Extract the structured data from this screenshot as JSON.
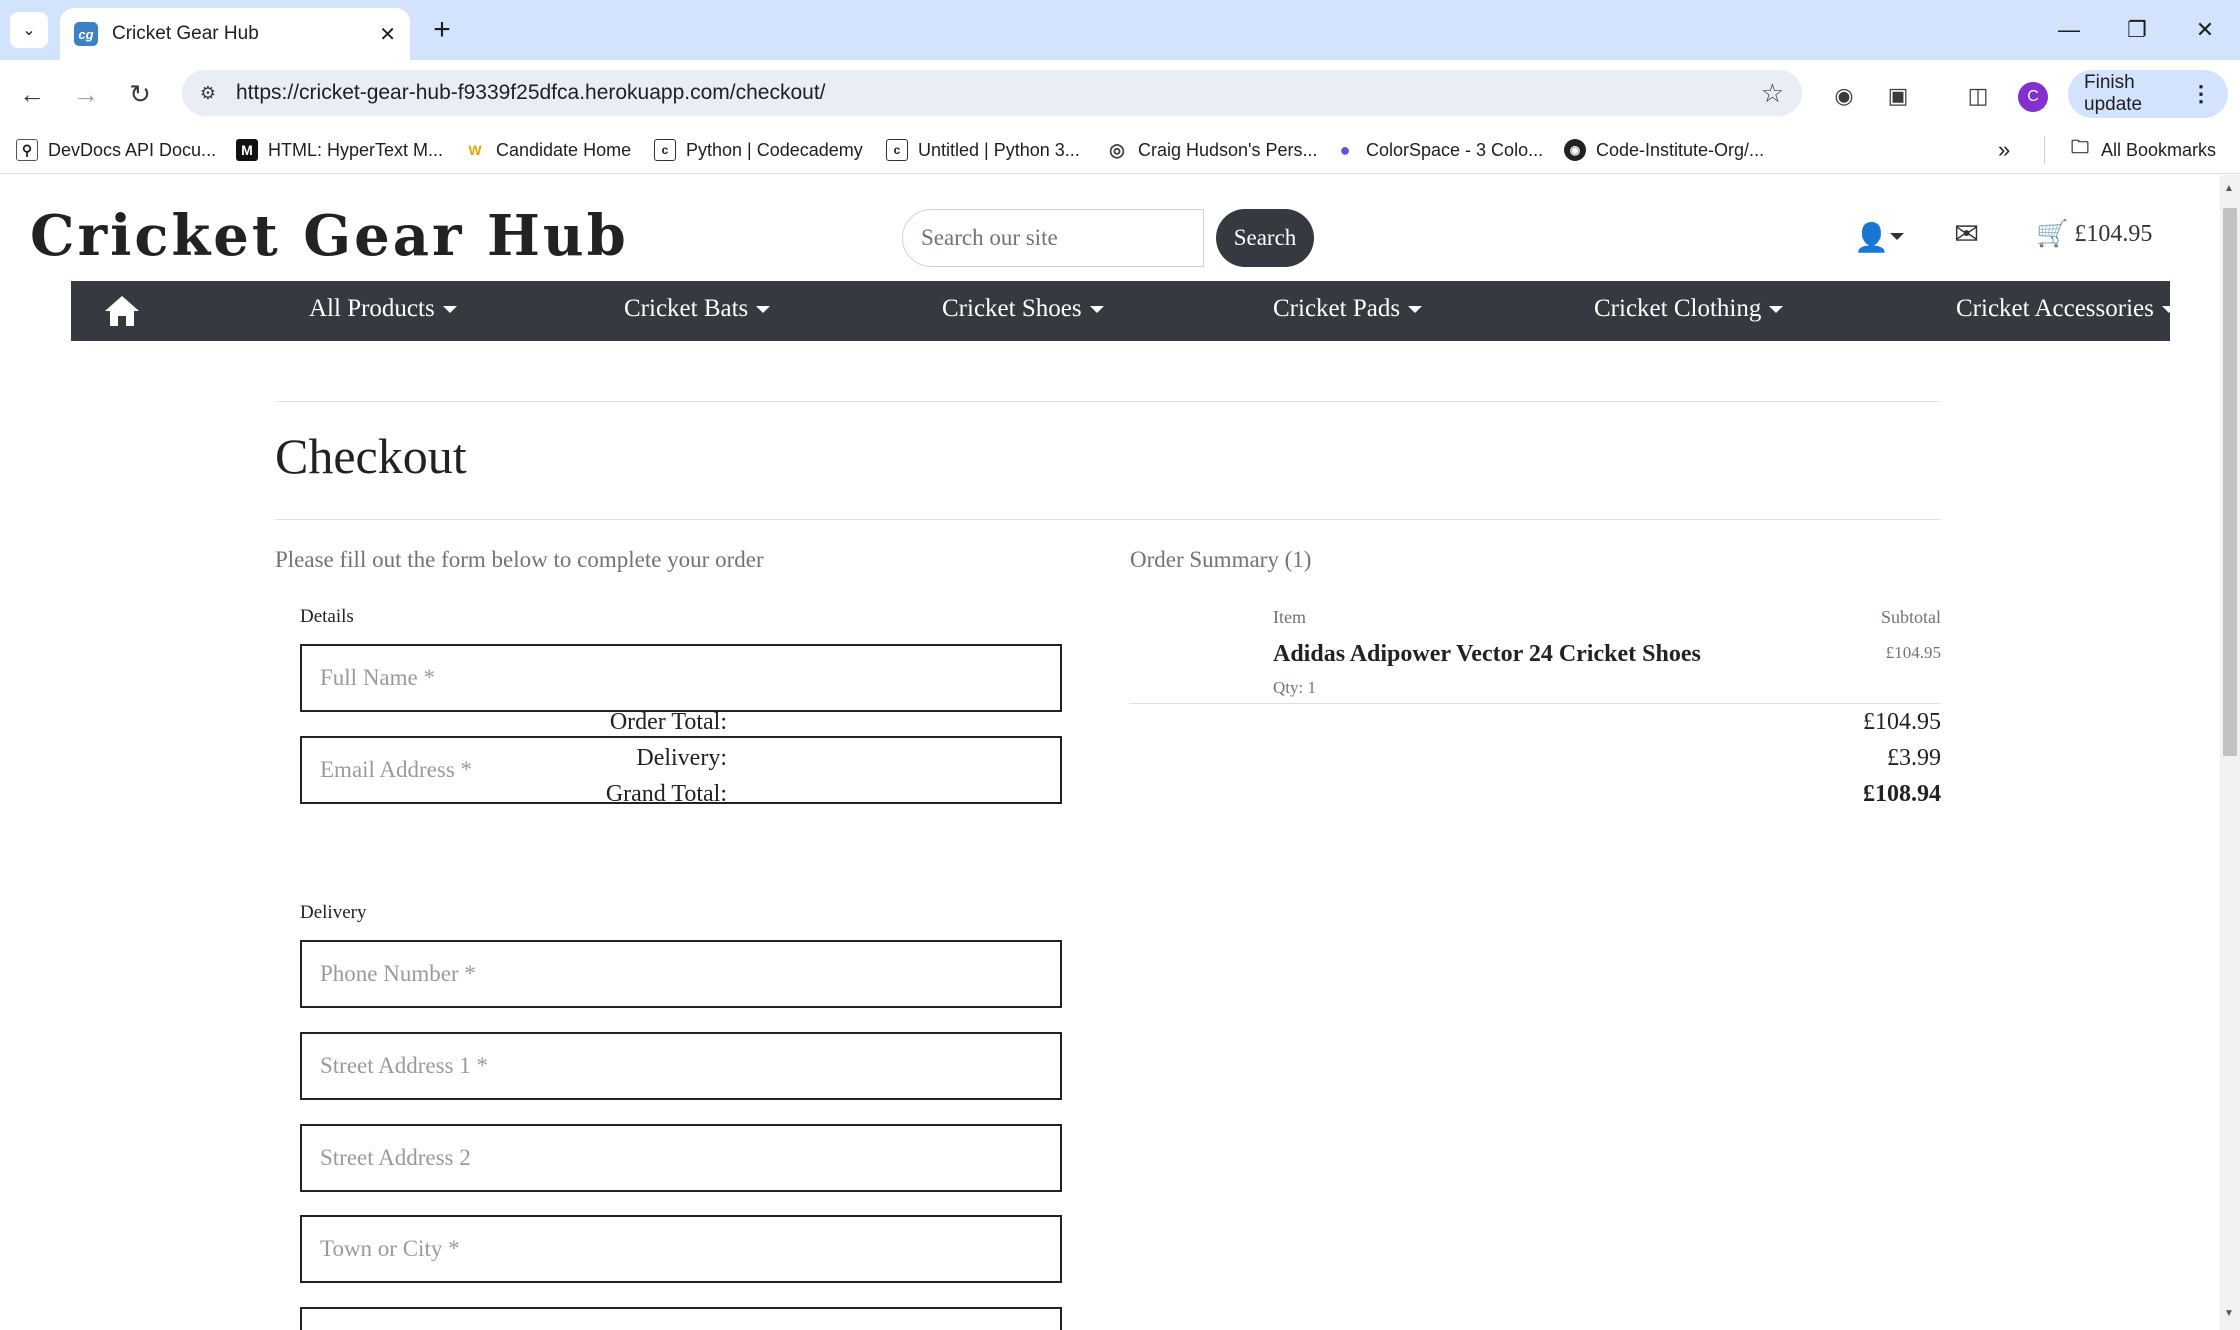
{
  "browser": {
    "tab_title": "Cricket Gear Hub",
    "tab_favicon": "cg",
    "url": "https://cricket-gear-hub-f9339f25dfca.herokuapp.com/checkout/",
    "finish_update": "Finish update",
    "profile_initial": "C",
    "bookmarks": [
      {
        "label": "DevDocs API Docu...",
        "icon": "devdocs-icon"
      },
      {
        "label": "HTML: HyperText M...",
        "icon": "mdn-icon"
      },
      {
        "label": "Candidate Home",
        "icon": "w-icon"
      },
      {
        "label": "Python | Codecademy",
        "icon": "codecademy-icon"
      },
      {
        "label": "Untitled | Python 3...",
        "icon": "codecademy-icon"
      },
      {
        "label": "Craig Hudson's Pers...",
        "icon": "globe-icon"
      },
      {
        "label": "ColorSpace - 3 Colo...",
        "icon": "colorspace-icon"
      },
      {
        "label": "Code-Institute-Org/...",
        "icon": "github-icon"
      }
    ],
    "all_bookmarks": "All Bookmarks"
  },
  "site": {
    "logo": "Cricket Gear Hub",
    "search_placeholder": "Search our site",
    "search_button": "Search",
    "cart_total": "£104.95",
    "nav": [
      "All Products",
      "Cricket Bats",
      "Cricket Shoes",
      "Cricket Pads",
      "Cricket Clothing",
      "Cricket Accessories"
    ]
  },
  "checkout": {
    "title": "Checkout",
    "intro": "Please fill out the form below to complete your order",
    "details_legend": "Details",
    "delivery_legend": "Delivery",
    "fields": {
      "full_name": "Full Name *",
      "email": "Email Address *",
      "phone": "Phone Number *",
      "street1": "Street Address 1 *",
      "street2": "Street Address 2",
      "town": "Town or City *"
    }
  },
  "summary": {
    "title": "Order Summary (1)",
    "col_item": "Item",
    "col_subtotal": "Subtotal",
    "product_name": "Adidas Adipower Vector 24 Cricket Shoes",
    "product_qty": "Qty: 1",
    "product_price": "£104.95",
    "order_total_label": "Order Total:",
    "order_total": "£104.95",
    "delivery_label": "Delivery:",
    "delivery": "£3.99",
    "grand_total_label": "Grand Total:",
    "grand_total": "£108.94"
  },
  "colors": {
    "chrome_tabstrip": "#d3e3fd",
    "navbar": "#343a40",
    "profile": "#8430ce"
  }
}
